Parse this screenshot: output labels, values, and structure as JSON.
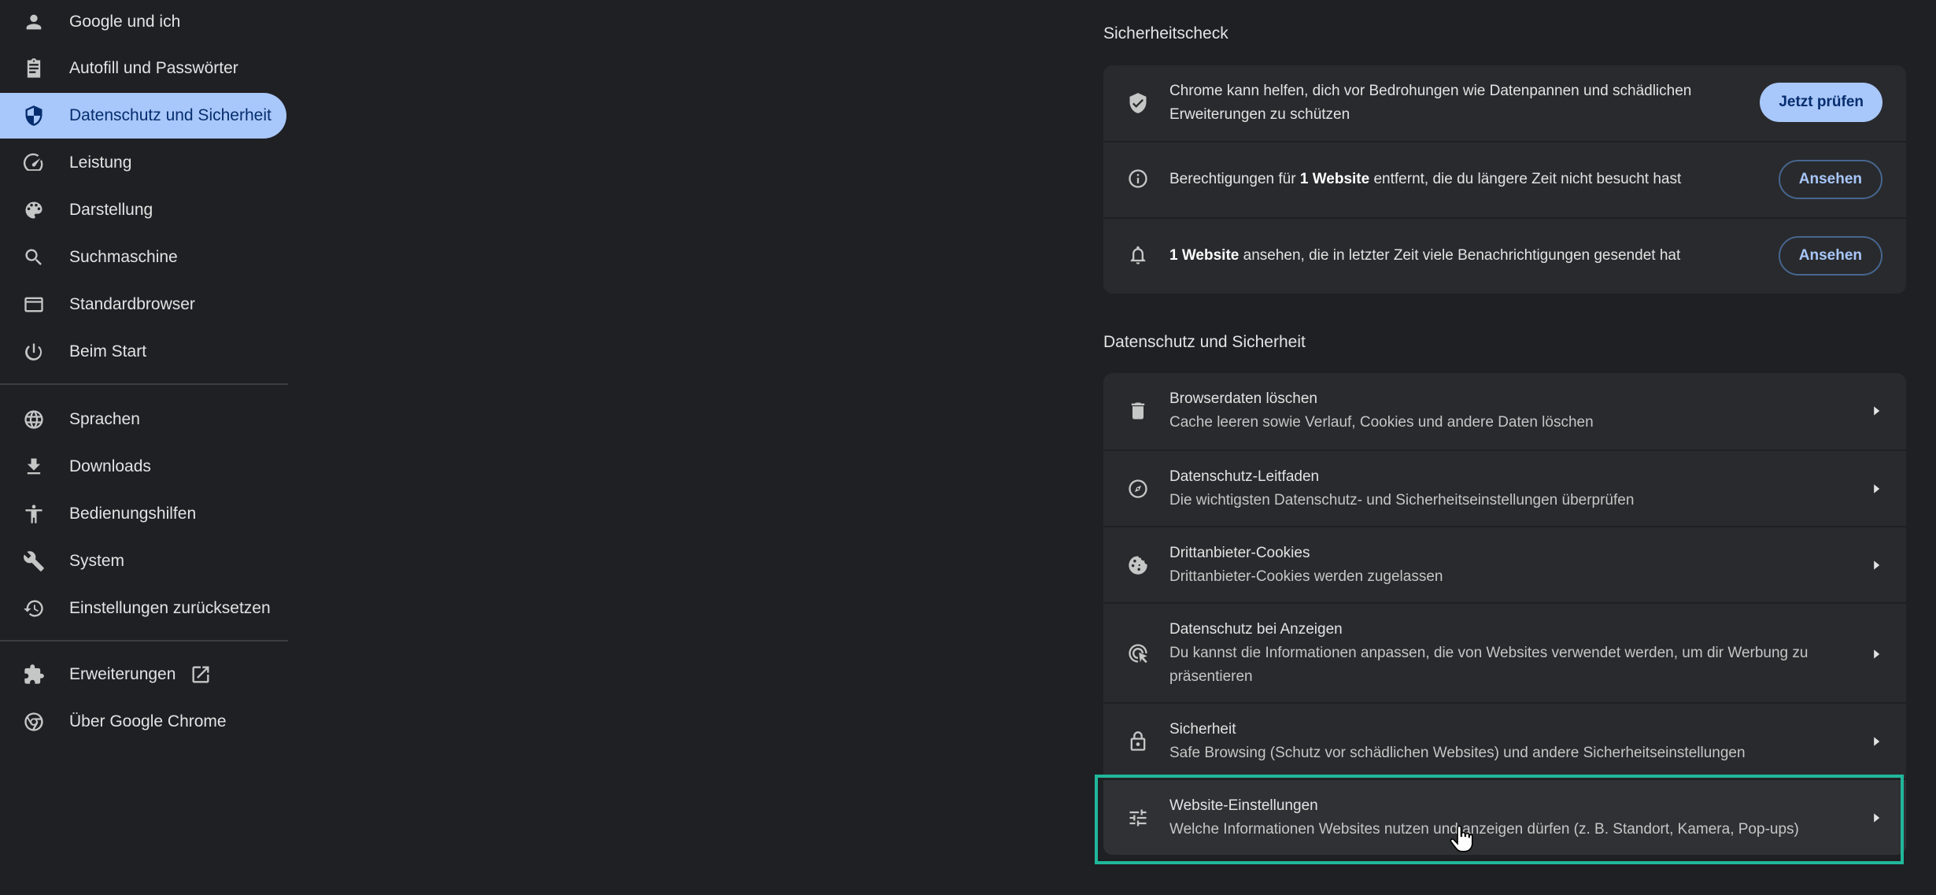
{
  "sidebar": {
    "items": [
      {
        "label": "Google und ich",
        "icon": "person-icon"
      },
      {
        "label": "Autofill und Passwörter",
        "icon": "clipboard-icon"
      },
      {
        "label": "Datenschutz und Sicherheit",
        "icon": "shield-icon",
        "active": true
      },
      {
        "label": "Leistung",
        "icon": "speedometer-icon"
      },
      {
        "label": "Darstellung",
        "icon": "palette-icon"
      },
      {
        "label": "Suchmaschine",
        "icon": "search-icon"
      },
      {
        "label": "Standardbrowser",
        "icon": "browser-window-icon"
      },
      {
        "label": "Beim Start",
        "icon": "power-icon"
      },
      {
        "label": "Sprachen",
        "icon": "globe-icon"
      },
      {
        "label": "Downloads",
        "icon": "download-icon"
      },
      {
        "label": "Bedienungshilfen",
        "icon": "accessibility-icon"
      },
      {
        "label": "System",
        "icon": "wrench-icon"
      },
      {
        "label": "Einstellungen zurücksetzen",
        "icon": "history-reset-icon"
      },
      {
        "label": "Erweiterungen",
        "icon": "puzzle-icon"
      },
      {
        "label": "Über Google Chrome",
        "icon": "chrome-icon"
      }
    ]
  },
  "safety_check": {
    "title": "Sicherheitscheck",
    "rows": [
      {
        "icon": "shield-check-icon",
        "text_line1": "Chrome kann helfen, dich vor Bedrohungen wie Datenpannen und schädlichen",
        "text_line2": "Erweiterungen zu schützen",
        "button": "Jetzt prüfen"
      },
      {
        "icon": "info-icon",
        "text_pre": "Berechtigungen für ",
        "text_bold": "1 Website",
        "text_post": " entfernt, die du längere Zeit nicht besucht hast",
        "button": "Ansehen"
      },
      {
        "icon": "bell-icon",
        "text_pre": "",
        "text_bold": "1 Website",
        "text_post": " ansehen, die in letzter Zeit viele Benachrichtigungen gesendet hat",
        "button": "Ansehen"
      }
    ]
  },
  "privacy": {
    "title": "Datenschutz und Sicherheit",
    "rows": [
      {
        "icon": "trash-icon",
        "title": "Browserdaten löschen",
        "sub": "Cache leeren sowie Verlauf, Cookies und andere Daten löschen"
      },
      {
        "icon": "compass-guide-icon",
        "title": "Datenschutz-Leitfaden",
        "sub": "Die wichtigsten Datenschutz- und Sicherheitseinstellungen überprüfen"
      },
      {
        "icon": "cookie-icon",
        "title": "Drittanbieter-Cookies",
        "sub": "Drittanbieter-Cookies werden zugelassen"
      },
      {
        "icon": "ad-privacy-icon",
        "title": "Datenschutz bei Anzeigen",
        "sub": "Du kannst die Informationen anpassen, die von Websites verwendet werden, um dir Werbung zu",
        "sub2": "präsentieren"
      },
      {
        "icon": "lock-icon",
        "title": "Sicherheit",
        "sub": "Safe Browsing (Schutz vor schädlichen Websites) und andere Sicherheitseinstellungen"
      },
      {
        "icon": "tune-sliders-icon",
        "title": "Website-Einstellungen",
        "sub": "Welche Informationen Websites nutzen und anzeigen dürfen (z. B. Standort, Kamera, Pop-ups)"
      }
    ]
  },
  "colors": {
    "background": "#1f2024",
    "card": "#292a2d",
    "accent": "#a8c7fa",
    "highlight": "#20b89b"
  }
}
